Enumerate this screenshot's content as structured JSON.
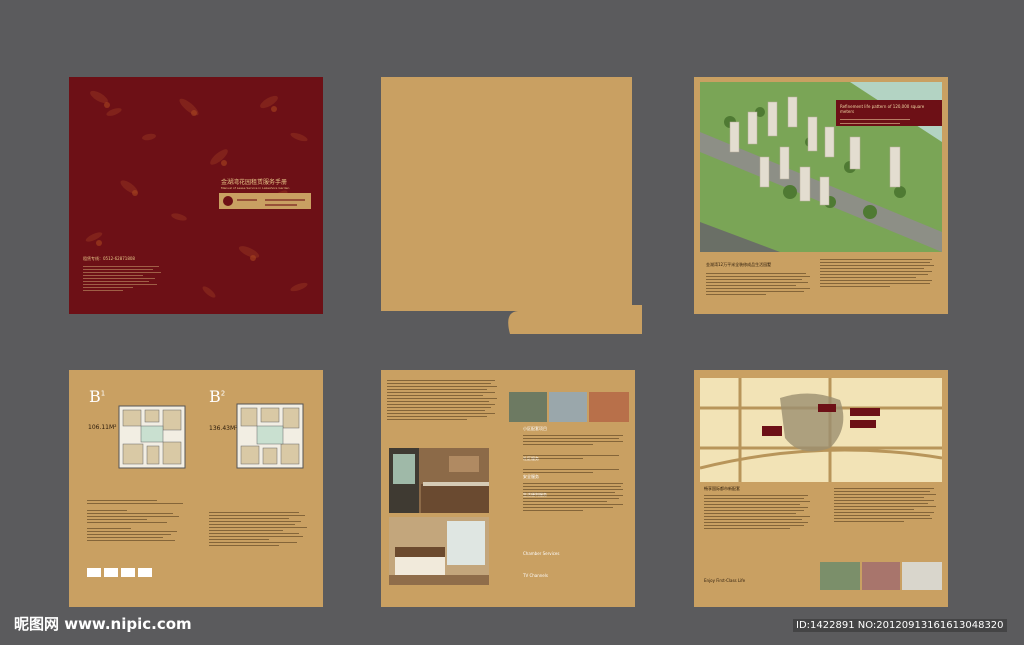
{
  "cover": {
    "title_cn": "金湖湾花园租赁服务手册",
    "title_en": "Manual of Lease Service in Lakeshore Garden",
    "phone_line": "租赁专线：0512-62871808"
  },
  "aerial": {
    "caption_en": "Refinement life pattern of 120,000 square meters",
    "caption_cn": "金湖湾12万平米全装修成品生活园墅"
  },
  "floorplans": {
    "b1": {
      "label": "B",
      "sup": "1",
      "area": "106.11M²"
    },
    "b2": {
      "label": "B",
      "sup": "2",
      "area": "136.43M²"
    }
  },
  "amenities": {
    "headings": [
      "小区配套项目",
      "社区服务",
      "安全服务",
      "生活便利服务"
    ],
    "en_headings": [
      "Chamber Services",
      "TV Channels"
    ]
  },
  "map_page": {
    "heading_cn": "畅享国际都市新配套",
    "heading_en": "Enjoy First-Class Life"
  },
  "watermark": {
    "site": "昵图网 www.nipic.com",
    "id": "ID:1422891 NO:20120913161613048320"
  },
  "colors": {
    "background": "#5b5b5d",
    "gold": "#c9a062",
    "maroon": "#6d1016"
  }
}
